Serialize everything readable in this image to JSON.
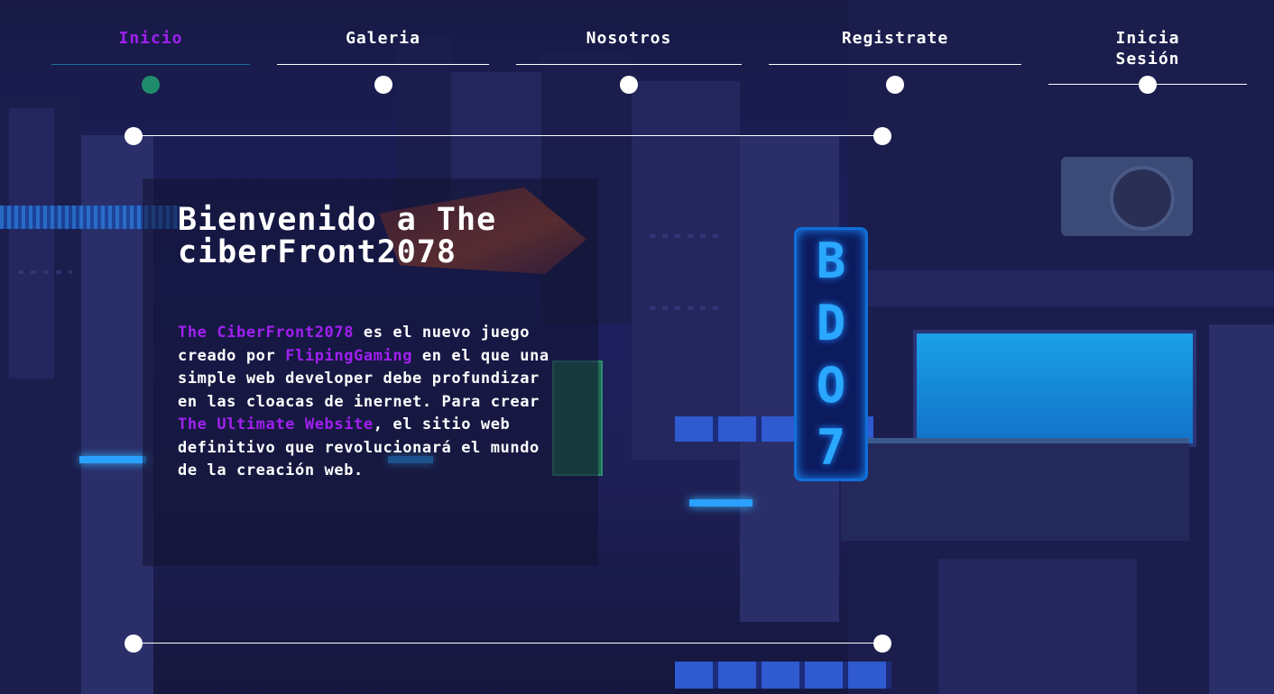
{
  "nav": {
    "items": [
      {
        "label": "Inicio",
        "active": true
      },
      {
        "label": "Galeria",
        "active": false
      },
      {
        "label": "Nosotros",
        "active": false
      },
      {
        "label": "Registrate",
        "active": false
      },
      {
        "label": "Inicia Sesión",
        "active": false
      }
    ]
  },
  "hero": {
    "title": "Bienvenido a The ciberFront2078",
    "body": {
      "p1_highlight": "The CiberFront2078",
      "p1_text": " es el nuevo juego creado por ",
      "p2_highlight": "FlipingGaming",
      "p2_text": " en el que una simple web developer debe profundizar en las cloacas de inernet. Para crear ",
      "p3_highlight": "The Ultimate Website",
      "p3_text": ", el sitio web definitivo que revolucionará el mundo de la creación web."
    }
  },
  "background": {
    "neon_sign_letters": [
      "B",
      "D",
      "O",
      "7"
    ]
  },
  "colors": {
    "accent": "#a020f0",
    "active_dot": "#1f8c6c",
    "text": "#ffffff",
    "background": "#1c2060"
  }
}
